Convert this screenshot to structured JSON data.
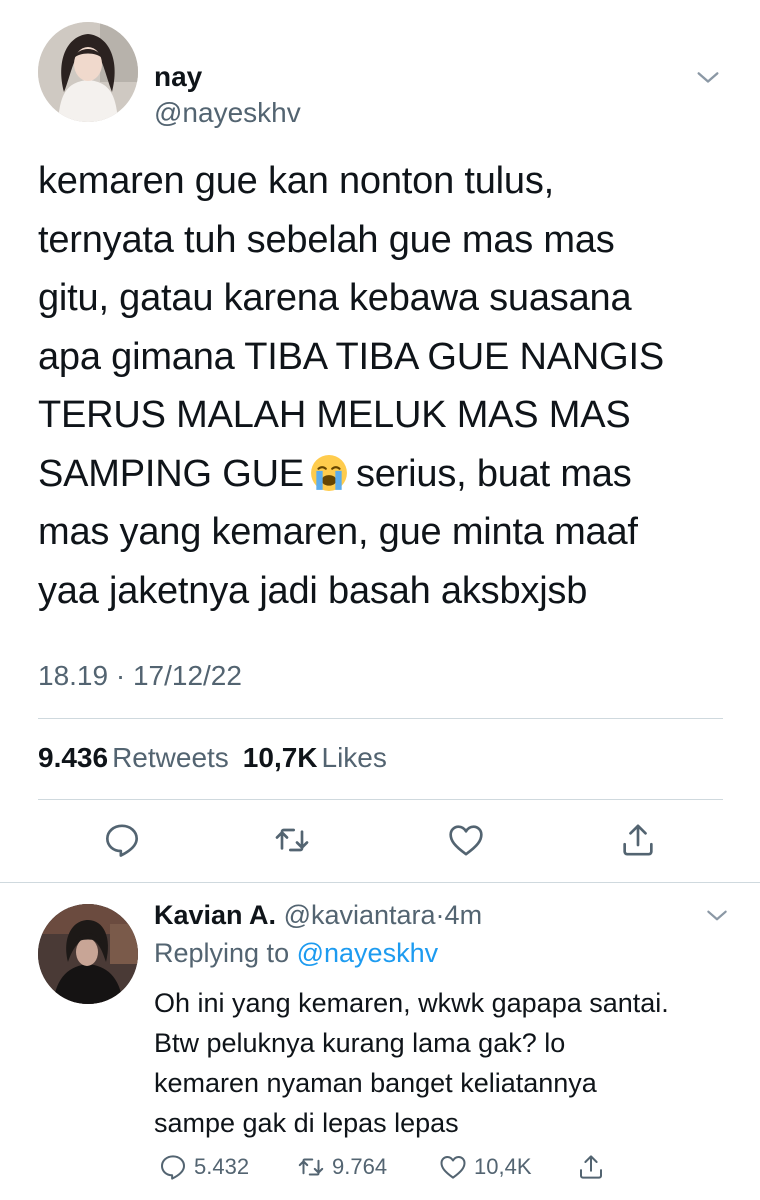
{
  "main_tweet": {
    "author": {
      "name": "nay",
      "handle": "@nayeskhv"
    },
    "text_lines": [
      "kemaren gue kan nonton tulus,",
      "ternyata tuh sebelah gue mas mas",
      "gitu, gatau karena kebawa suasana",
      "apa gimana TIBA TIBA GUE NANGIS",
      "TERUS MALAH MELUK MAS MAS",
      "SAMPING GUE",
      "serius, buat mas",
      "mas yang kemaren, gue minta maaf",
      "yaa jaketnya jadi basah aksbxjsb"
    ],
    "emoji": "loudly-crying-face-emoji",
    "timestamp": "18.19 · 17/12/22",
    "stats": {
      "retweets_count": "9.436",
      "retweets_label": "Retweets",
      "likes_count": "10,7K",
      "likes_label": "Likes"
    },
    "actions": [
      "reply-icon",
      "retweet-icon",
      "like-icon",
      "share-icon"
    ]
  },
  "reply": {
    "author": {
      "name": "Kavian A.",
      "handle": "@kaviantara",
      "separator": "·",
      "time": "4m"
    },
    "replying_prefix": "Replying to",
    "replying_to": "@nayeskhv",
    "text_lines": [
      "Oh ini yang kemaren, wkwk gapapa santai.",
      "Btw peluknya kurang lama gak? lo",
      "kemaren nyaman banget keliatannya",
      "sampe gak di lepas lepas"
    ],
    "actions": {
      "reply_count": "5.432",
      "retweet_count": "9.764",
      "like_count": "10,4K"
    }
  },
  "colors": {
    "text": "#0f1419",
    "secondary": "#536471",
    "link": "#1d9bf0",
    "divider": "#cfd9de",
    "icon": "#536471"
  }
}
